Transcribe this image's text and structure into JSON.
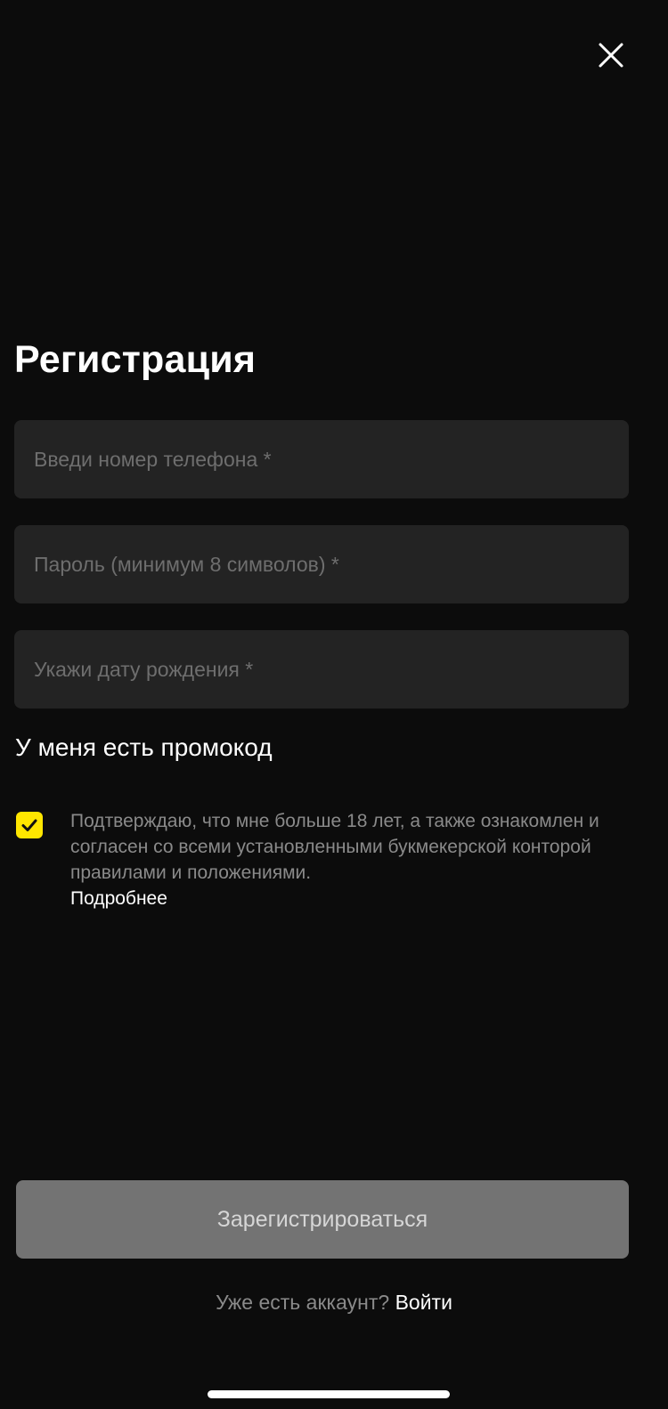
{
  "header": {
    "close_icon": "close-icon"
  },
  "form": {
    "title": "Регистрация",
    "phone": {
      "placeholder": "Введи номер телефона *",
      "value": ""
    },
    "password": {
      "placeholder": "Пароль (минимум 8 символов) *",
      "value": ""
    },
    "birth_date": {
      "placeholder": "Укажи дату рождения *",
      "value": ""
    },
    "promo_label": "У меня есть промокод"
  },
  "consent": {
    "checked": true,
    "text": "Подтверждаю, что мне больше 18 лет, а также ознакомлен и согласен со всеми установленными букмекерской конторой правилами и положениями.",
    "more_link": "Подробнее"
  },
  "actions": {
    "submit_label": "Зарегистрироваться",
    "login_question": "Уже есть аккаунт?",
    "login_link": "Войти"
  },
  "colors": {
    "background": "#0c0c0c",
    "field_background": "#232323",
    "accent": "#ffe600",
    "button_disabled": "#737373"
  }
}
